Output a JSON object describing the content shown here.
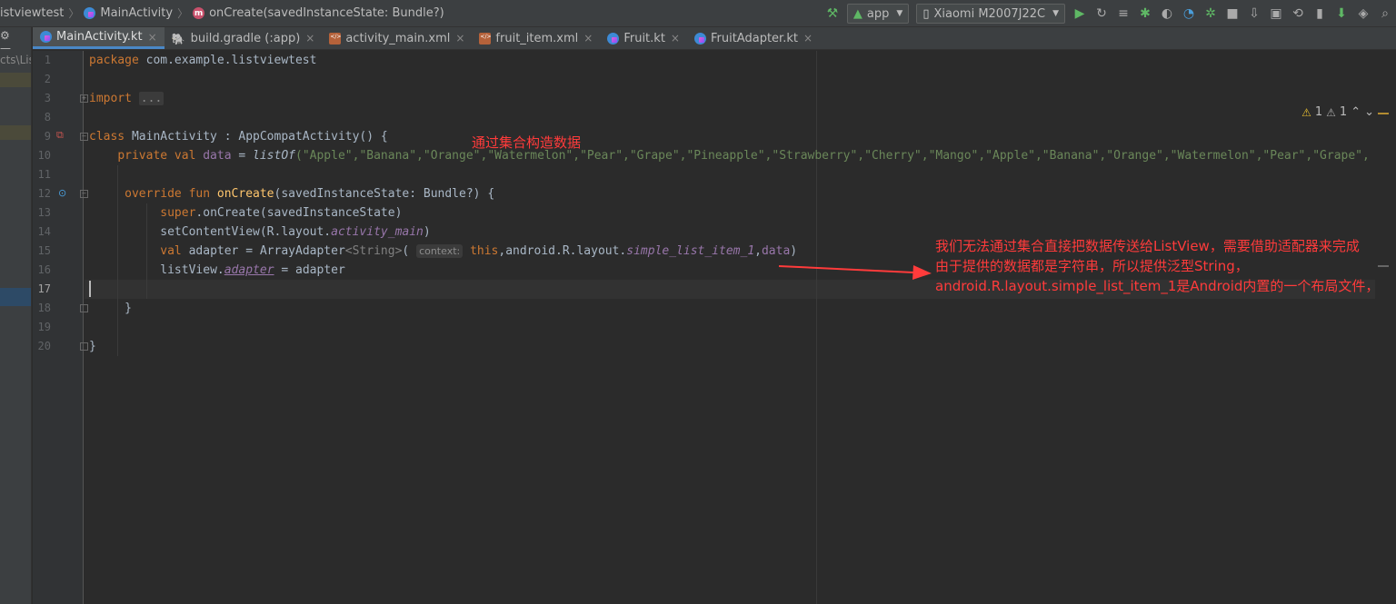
{
  "breadcrumb": {
    "project": "istviewtest",
    "file": "MainActivity",
    "method": "onCreate(savedInstanceState: Bundle?)"
  },
  "toolbar": {
    "run_config": "app",
    "device": "Xiaomi M2007J22C"
  },
  "tabs": [
    {
      "label": "MainActivity.kt",
      "active": true
    },
    {
      "label": "build.gradle (:app)",
      "active": false
    },
    {
      "label": "activity_main.xml",
      "active": false
    },
    {
      "label": "fruit_item.xml",
      "active": false
    },
    {
      "label": "Fruit.kt",
      "active": false
    },
    {
      "label": "FruitAdapter.kt",
      "active": false
    }
  ],
  "project_panel": {
    "path_fragment": "cts\\Lis"
  },
  "editor": {
    "line_numbers": [
      "1",
      "2",
      "3",
      "8",
      "9",
      "10",
      "11",
      "12",
      "13",
      "14",
      "15",
      "16",
      "17",
      "18",
      "19",
      "20"
    ],
    "current_line": "17",
    "code": {
      "l1_kw": "package",
      "l1_rest": " com.example.listviewtest",
      "l3_kw": "import",
      "l3_fold": "...",
      "l9_kw": "class",
      "l9_rest": " MainActivity : AppCompatActivity() {",
      "l10_kw": "private val",
      "l10_var": " data",
      "l10_eq": " = ",
      "l10_fn": "listOf",
      "l10_args": "(\"Apple\",\"Banana\",\"Orange\",\"Watermelon\",\"Pear\",\"Grape\",\"Pineapple\",\"Strawberry\",\"Cherry\",\"Mango\",\"Apple\",\"Banana\",\"Orange\",\"Watermelon\",\"Pear\",\"Grape\",",
      "l12_kw": "override fun",
      "l12_fn": " onCreate",
      "l12_rest": "(savedInstanceState: Bundle?) {",
      "l13_kw": "super",
      "l13_rest": ".onCreate(savedInstanceState)",
      "l14_a": "setContentView(R.layout.",
      "l14_b": "activity_main",
      "l14_c": ")",
      "l15_kw": "val",
      "l15_a": " adapter = ArrayAdapter",
      "l15_gen": "<String>",
      "l15_b": "(",
      "l15_hint": "context:",
      "l15_this": "this",
      "l15_c": ",android.R.layout.",
      "l15_d": "simple_list_item_1",
      "l15_e": ",",
      "l15_data": "data",
      "l15_f": ")",
      "l16_a": "listView.",
      "l16_b": "adapter",
      "l16_c": " = adapter",
      "l18": "}",
      "l20": "}"
    }
  },
  "inspections": {
    "warnings": "1",
    "weak_warnings": "1"
  },
  "annotations": {
    "note1": "通过集合构造数据",
    "note2_line1": "我们无法通过集合直接把数据传送给ListView，需要借助适配器来完成",
    "note2_line2": "由于提供的数据都是字符串，所以提供泛型String，",
    "note2_line3": "android.R.layout.simple_list_item_1是Android内置的一个布局文件，",
    "color": "#ff3b3b"
  }
}
